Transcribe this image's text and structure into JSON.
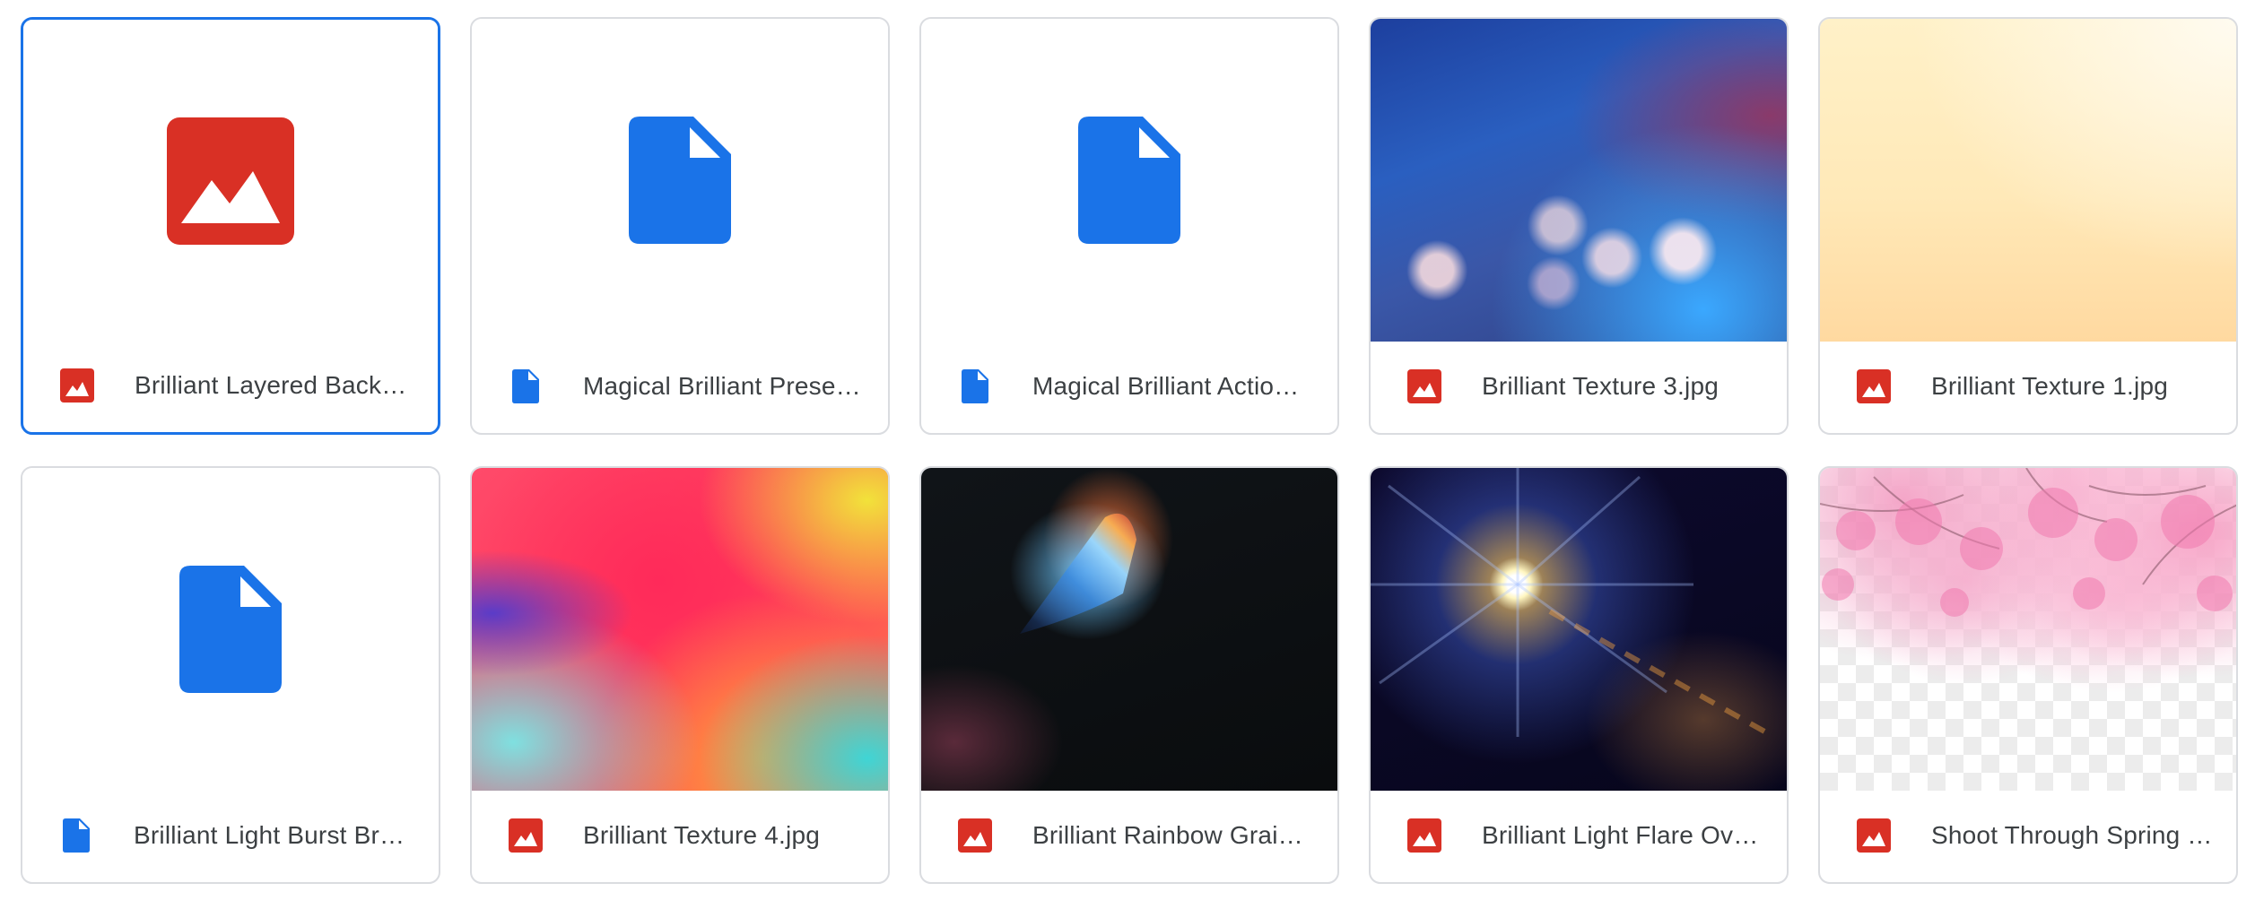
{
  "colors": {
    "image_red": "#d93025",
    "doc_blue": "#1a73e8",
    "selected_border": "#1a73e8",
    "card_border": "#dadce0",
    "title_text": "#3c4043"
  },
  "items": [
    {
      "title": "Brilliant Layered Backg…",
      "type_icon": "image-file-icon",
      "preview": "large-image-placeholder-icon",
      "selected": true
    },
    {
      "title": "Magical Brilliant Prese…",
      "type_icon": "document-file-icon",
      "preview": "large-document-icon"
    },
    {
      "title": "Magical Brilliant Actio…",
      "type_icon": "document-file-icon",
      "preview": "large-document-icon"
    },
    {
      "title": "Brilliant Texture 3.jpg",
      "type_icon": "image-file-icon",
      "preview": "blue-bokeh-texture"
    },
    {
      "title": "Brilliant Texture 1.jpg",
      "type_icon": "image-file-icon",
      "preview": "cream-gradient-texture"
    },
    {
      "title": "Brilliant Light Burst Br…",
      "type_icon": "document-file-icon",
      "preview": "large-document-icon"
    },
    {
      "title": "Brilliant Texture 4.jpg",
      "type_icon": "image-file-icon",
      "preview": "rainbow-watercolor-texture"
    },
    {
      "title": "Brilliant Rainbow Grain…",
      "type_icon": "image-file-icon",
      "preview": "rainbow-prism-leak"
    },
    {
      "title": "Brilliant Light Flare Ov…",
      "type_icon": "image-file-icon",
      "preview": "lens-flare-burst"
    },
    {
      "title": "Shoot Through Spring …",
      "type_icon": "image-file-icon",
      "preview": "cherry-blossom-overlay"
    }
  ]
}
